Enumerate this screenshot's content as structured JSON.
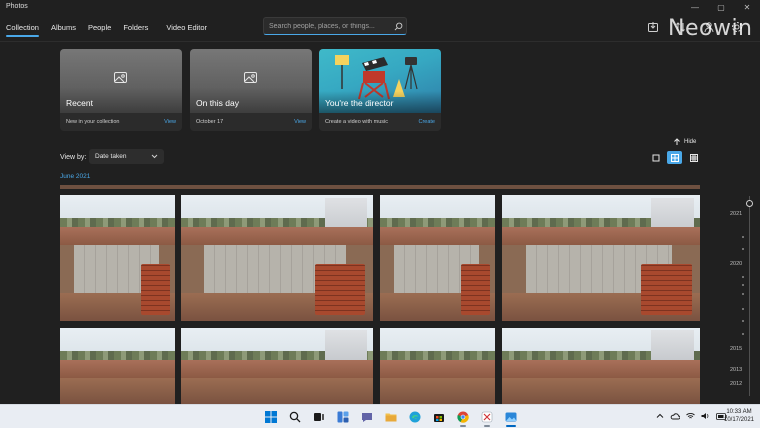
{
  "app": {
    "title": "Photos"
  },
  "window": {
    "minimize": "—",
    "maximize": "▢",
    "close": "✕"
  },
  "nav": {
    "tabs": [
      "Collection",
      "Albums",
      "People",
      "Folders",
      "Video Editor"
    ]
  },
  "search": {
    "placeholder": "Search people, places, or things..."
  },
  "header_icons": [
    "import-icon",
    "sort-icon",
    "people-icon",
    "settings-icon"
  ],
  "watermark": "Neowin",
  "cards": [
    {
      "title": "Recent",
      "subtitle": "New in your collection",
      "link": "View"
    },
    {
      "title": "On this day",
      "subtitle": "October 17",
      "link": "View"
    },
    {
      "title": "You're the director",
      "subtitle": "Create a video with music",
      "link": "Create"
    }
  ],
  "hide_label": "Hide",
  "view_by": {
    "label": "View by:",
    "value": "Date taken"
  },
  "group": {
    "label": "June 2021"
  },
  "timeline": {
    "years": [
      "2021",
      "2020",
      "2015",
      "2013",
      "2012"
    ]
  },
  "taskbar": {
    "apps": [
      "windows-start-icon",
      "search-icon",
      "task-view-icon",
      "widgets-icon",
      "teams-chat-icon",
      "file-explorer-icon",
      "edge-icon",
      "store-icon",
      "chrome-icon",
      "snipping-tool-icon",
      "photos-app-icon"
    ],
    "time": "10:33 AM",
    "date": "10/17/2021"
  },
  "colors": {
    "accent": "#4aa8e8",
    "background": "#202020",
    "taskbar": "#e9edf3"
  }
}
